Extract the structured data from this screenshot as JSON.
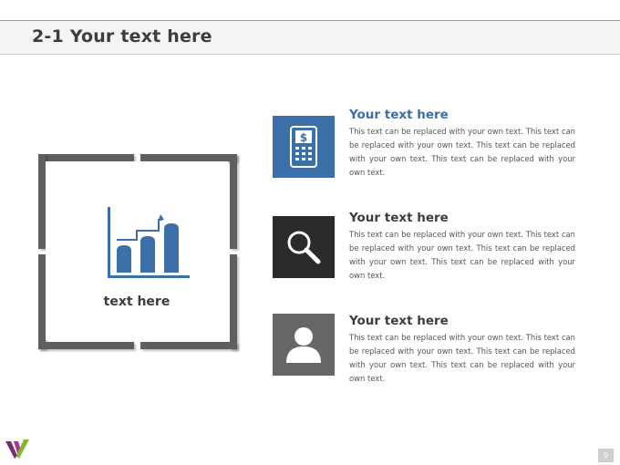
{
  "header": {
    "title": "2-1 Your text here"
  },
  "frame": {
    "label": "text here"
  },
  "items": [
    {
      "title": "Your text here",
      "text": "This text can be replaced with your own text. This text can be replaced with your own text. This text can be replaced with your own text. This text can be replaced with your own text.",
      "icon": "mobile-dollar-icon"
    },
    {
      "title": "Your text here",
      "text": "This text can be replaced with your own text. This text can be replaced with your own text. This text can be replaced with your own text. This text can be replaced with your own text.",
      "icon": "magnifier-icon"
    },
    {
      "title": "Your text here",
      "text": "This text can be replaced with your own text. This text can be replaced with your own text. This text can be replaced with your own text. This text can be replaced with your own text.",
      "icon": "user-icon"
    }
  ],
  "footer": {
    "page_number": "9"
  },
  "colors": {
    "accent_blue": "#3b6fa7",
    "dark_tile": "#2b2b2b",
    "gray_tile": "#666666",
    "frame_gray": "#5f5f5f",
    "logo_purple": "#7a2a6e",
    "logo_green": "#8ab531"
  }
}
